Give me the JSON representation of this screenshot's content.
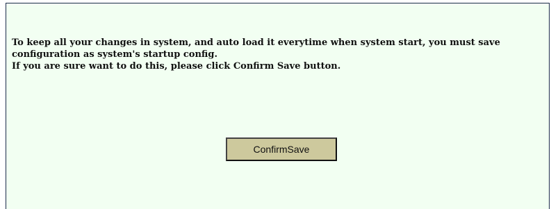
{
  "colors": {
    "panel_background": "#f2fff2",
    "panel_border": "#1c2b4a",
    "button_background": "#cdc99d",
    "text": "#111111"
  },
  "message": {
    "line1": "To keep all your changes in system, and auto load it everytime when system start, you must save configuration as system's startup config.",
    "line2": "If you are sure want to do this, please click Confirm Save button."
  },
  "actions": {
    "confirm_save_label": "ConfirmSave"
  }
}
